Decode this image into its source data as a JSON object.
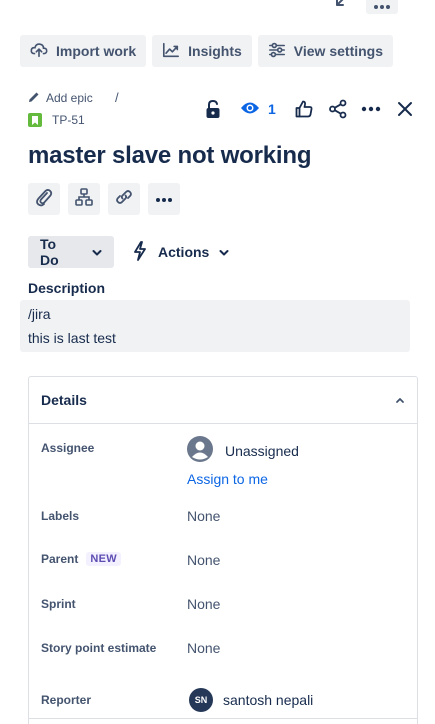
{
  "toolbar": {
    "import_label": "Import work",
    "insights_label": "Insights",
    "view_settings_label": "View settings"
  },
  "issue": {
    "add_epic_label": "Add epic",
    "breadcrumb_separator": "/",
    "key": "TP-51",
    "watch_count": "1",
    "title": "master slave not working",
    "status": "To Do",
    "actions_label": "Actions"
  },
  "description": {
    "label": "Description",
    "lines": [
      "/jira",
      "this is last test"
    ]
  },
  "details": {
    "title": "Details",
    "assignee_label": "Assignee",
    "assignee_value": "Unassigned",
    "assign_to_me": "Assign to me",
    "labels_label": "Labels",
    "labels_value": "None",
    "parent_label": "Parent",
    "parent_badge": "NEW",
    "parent_value": "None",
    "sprint_label": "Sprint",
    "sprint_value": "None",
    "story_points_label": "Story point estimate",
    "story_points_value": "None",
    "reporter_label": "Reporter",
    "reporter_initials": "SN",
    "reporter_value": "santosh nepali"
  },
  "colors": {
    "accent": "#0c66e4",
    "story_icon": "#63ba3c",
    "button_bg": "#f1f2f4",
    "text": "#172b4d"
  },
  "icons": [
    "collapse-icon",
    "more-icon",
    "import-icon",
    "insights-icon",
    "settings-icon",
    "pencil-icon",
    "story-icon",
    "unlock-icon",
    "eye-icon",
    "thumbs-up-icon",
    "share-icon",
    "close-icon",
    "attachment-icon",
    "child-issue-icon",
    "link-icon",
    "chevron-down-icon",
    "lightning-icon",
    "chevron-up-icon",
    "user-avatar-icon"
  ]
}
